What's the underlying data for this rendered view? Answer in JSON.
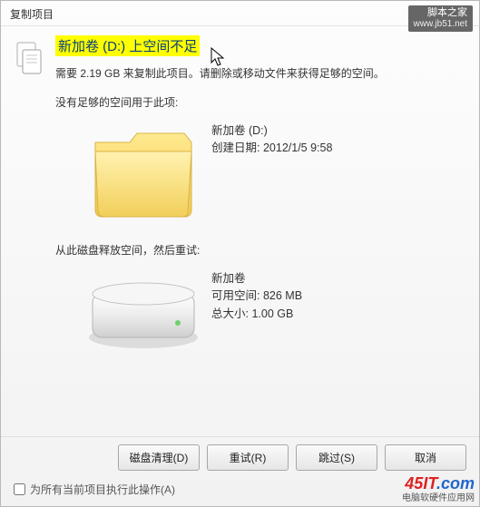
{
  "title": "复制项目",
  "headline": "新加卷 (D:) 上空间不足",
  "description": "需要 2.19 GB 来复制此项目。请删除或移动文件来获得足够的空间。",
  "section1": {
    "label": "没有足够的空间用于此项:",
    "name": "新加卷 (D:)",
    "created_label": "创建日期:",
    "created_value": "2012/1/5 9:58"
  },
  "section2": {
    "label": "从此磁盘释放空间，然后重试:",
    "name": "新加卷",
    "avail_label": "可用空间:",
    "avail_value": "826 MB",
    "total_label": "总大小:",
    "total_value": "1.00 GB"
  },
  "buttons": {
    "cleanup": "磁盘清理(D)",
    "retry": "重试(R)",
    "skip": "跳过(S)",
    "cancel": "取消"
  },
  "footer_checkbox": "为所有当前项目执行此操作(A)",
  "watermark1": {
    "line1": "脚本之家",
    "line2": "www.jb51.net"
  },
  "watermark2": {
    "logo_a": "45IT",
    "logo_b": ".com",
    "sub": "电脑软硬件应用网"
  }
}
